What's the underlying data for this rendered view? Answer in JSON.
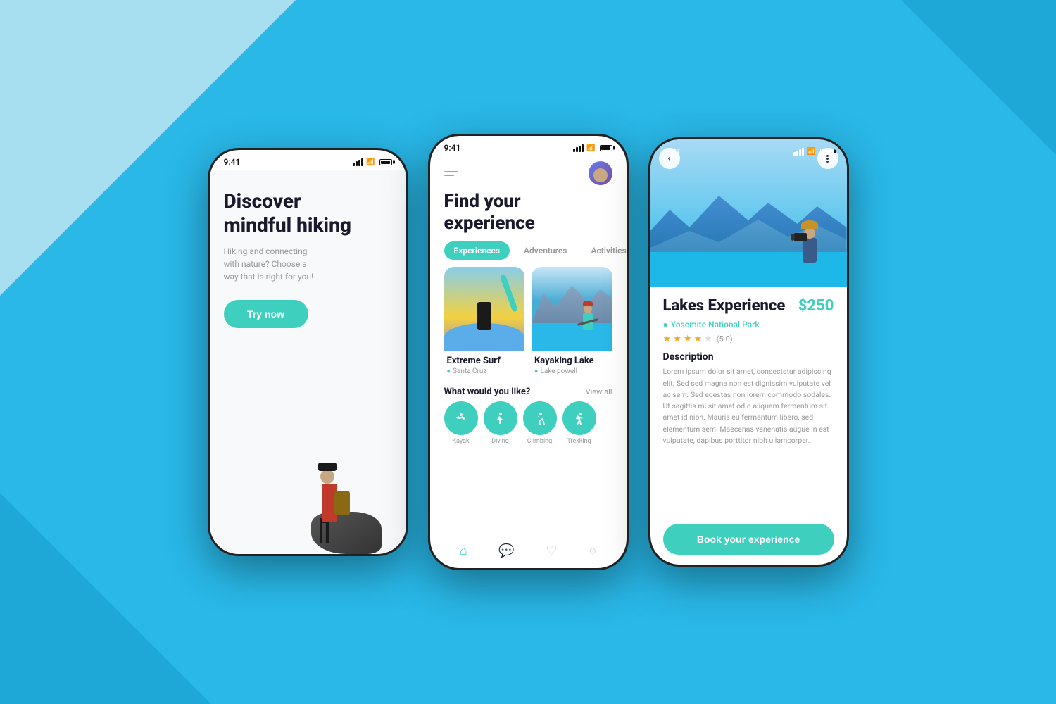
{
  "background": {
    "color": "#29b8e8"
  },
  "phone1": {
    "status_time": "9:41",
    "title_line1": "Discover",
    "title_line2": "mindful hiking",
    "subtitle": "Hiking and connecting with nature? Choose a way that is right for you!",
    "cta_button": "Try now"
  },
  "phone2": {
    "status_time": "9:41",
    "title_line1": "Find your",
    "title_line2": "experience",
    "tabs": [
      "Experiences",
      "Adventures",
      "Activities"
    ],
    "active_tab": "Experiences",
    "cards": [
      {
        "name": "Extreme Surf",
        "location": "Santa Cruz"
      },
      {
        "name": "Kayaking Lake",
        "location": "Lake powell"
      }
    ],
    "what_label": "What would you like?",
    "view_all": "View all",
    "activities": [
      "Kayak",
      "Diving",
      "Climbing",
      "Trekking"
    ]
  },
  "phone3": {
    "status_time": "9:41",
    "title": "Lakes Experience",
    "price": "$250",
    "location": "Yosemite National Park",
    "rating": "5.0",
    "filled_stars": 4,
    "empty_stars": 1,
    "description_label": "Description",
    "description_text": "Lorem ipsum dolor sit amet, consectetur adipiscing elit. Sed sed magna non est dignissim vulputate vel ac sem. Sed egestas non lorem commodo sodales. Ut sagittis mi sit amet odio aliquam fermentum sit amet id nibh. Mauris eu fermentum libero, sed elementum sem. Maecenas venenatis augue in est vulputate, dapibus porttitor nibh ullamcorper.",
    "book_button": "Book your experience"
  }
}
